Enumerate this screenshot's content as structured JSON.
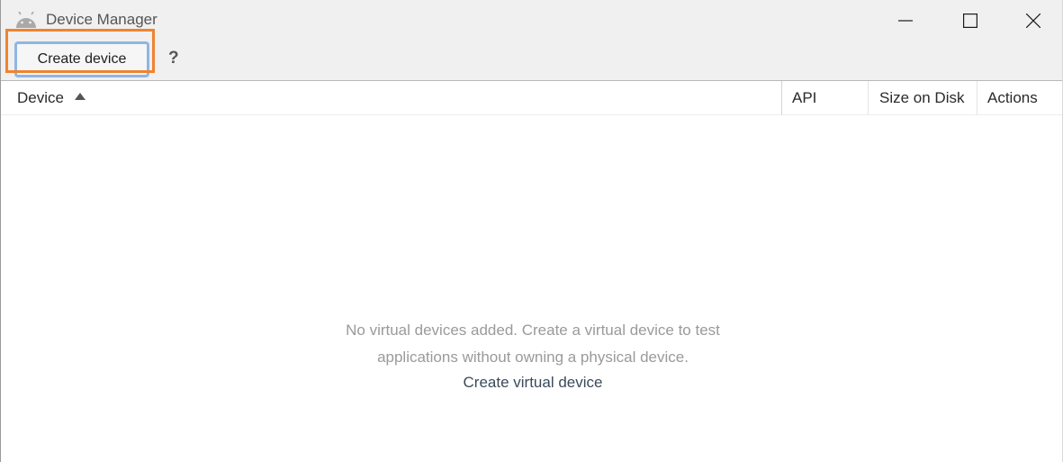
{
  "window": {
    "title": "Device Manager",
    "icon": "android-icon"
  },
  "toolbar": {
    "create_label": "Create device",
    "help_label": "?"
  },
  "table": {
    "columns": [
      {
        "label": "Device",
        "sort": "ascending"
      },
      {
        "label": "API"
      },
      {
        "label": "Size on Disk"
      },
      {
        "label": "Actions"
      }
    ]
  },
  "empty_state": {
    "line1": "No virtual devices added. Create a virtual device to test",
    "line2": "applications without owning a physical device.",
    "link": "Create virtual device"
  },
  "colors": {
    "highlight": "#f0832f",
    "focus_ring": "#8fb6e1",
    "android_icon": "#a9a9a9"
  }
}
